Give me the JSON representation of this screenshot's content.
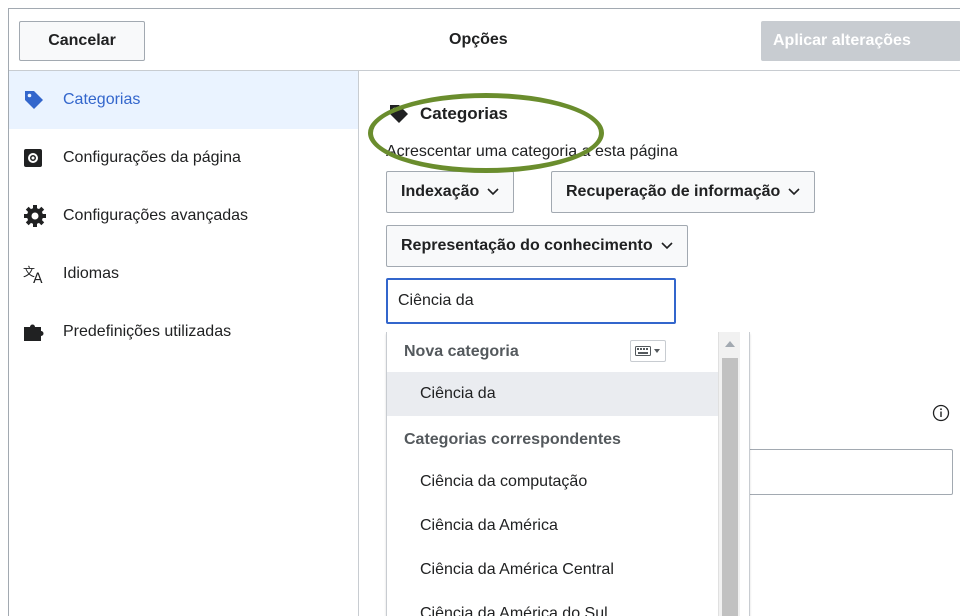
{
  "dialog": {
    "title": "Opções",
    "cancel_label": "Cancelar",
    "apply_label": "Aplicar alterações"
  },
  "nav": {
    "items": [
      {
        "label": "Categorias",
        "icon": "tag-icon",
        "active": true
      },
      {
        "label": "Configurações da página",
        "icon": "page-settings-icon",
        "active": false
      },
      {
        "label": "Configurações avançadas",
        "icon": "gear-icon",
        "active": false
      },
      {
        "label": "Idiomas",
        "icon": "language-icon",
        "active": false
      },
      {
        "label": "Predefinições utilizadas",
        "icon": "puzzle-icon",
        "active": false
      }
    ]
  },
  "categories": {
    "section_title": "Categorias",
    "hint": "Acrescentar uma categoria a esta página",
    "tags": [
      "Indexação",
      "Recuperação de informação",
      "Representação do conhecimento"
    ],
    "input_value": "Ciência da "
  },
  "suggestions": {
    "new_header": "Nova categoria",
    "new_option": "Ciência da",
    "matching_header": "Categorias correspondentes",
    "matching_options": [
      "Ciência da computação",
      "Ciência da América",
      "Ciência da América Central",
      "Ciência da América do Sul"
    ]
  },
  "colors": {
    "accent": "#3366cc",
    "active_nav_bg": "#eaf3ff",
    "highlight_oval": "#6a8d2d",
    "apply_disabled": "#c8ccd1"
  }
}
